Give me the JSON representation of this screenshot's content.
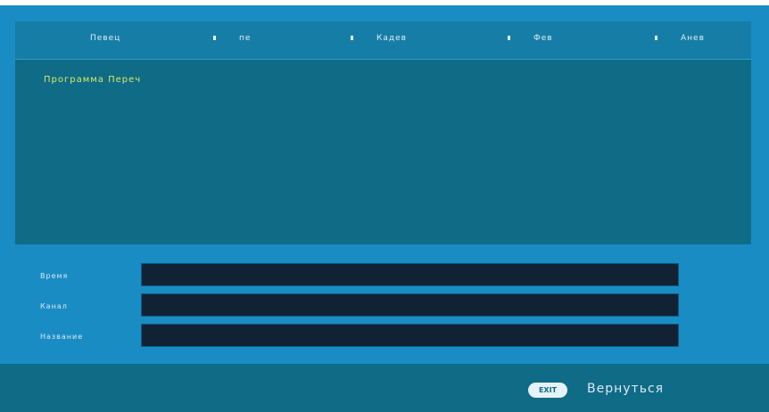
{
  "tabs": [
    {
      "label": "Певец"
    },
    {
      "label": "пе"
    },
    {
      "label": "Кадев"
    },
    {
      "label": "Фев"
    },
    {
      "label": "Анев"
    }
  ],
  "channel_list": {
    "selected_text": "Программа Переч"
  },
  "form": {
    "fields": [
      {
        "label": "Время",
        "value": ""
      },
      {
        "label": "Канал",
        "value": ""
      },
      {
        "label": "Название",
        "value": ""
      }
    ]
  },
  "footer": {
    "exit_key": "EXIT",
    "exit_label": "Вернуться"
  },
  "colors": {
    "screen_bg": "#1a8cc4",
    "panel_bg": "#0f6b86",
    "highlight_text": "#d7e86a",
    "field_bg": "#102233"
  }
}
